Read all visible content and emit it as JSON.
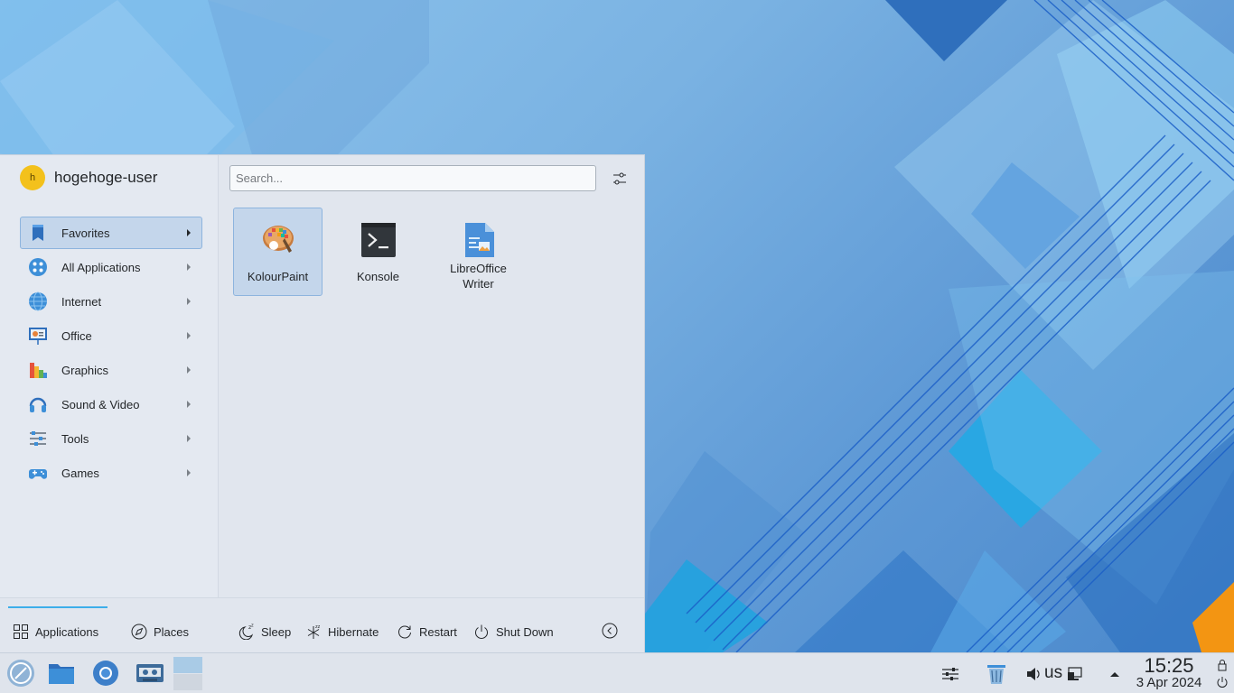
{
  "launcher": {
    "user": {
      "avatar_letter": "h",
      "name": "hogehoge-user"
    },
    "search": {
      "placeholder": "Search...",
      "value": ""
    },
    "categories": [
      {
        "label": "Favorites",
        "icon": "bookmark-icon",
        "selected": true
      },
      {
        "label": "All Applications",
        "icon": "all-applications-icon"
      },
      {
        "label": "Internet",
        "icon": "globe-icon"
      },
      {
        "label": "Office",
        "icon": "presentation-icon"
      },
      {
        "label": "Graphics",
        "icon": "color-palette-icon"
      },
      {
        "label": "Sound & Video",
        "icon": "headphones-icon"
      },
      {
        "label": "Tools",
        "icon": "sliders-icon"
      },
      {
        "label": "Games",
        "icon": "gamepad-icon"
      }
    ],
    "apps": [
      {
        "label": "KolourPaint",
        "icon": "kolourpaint-icon",
        "selected": true
      },
      {
        "label": "Konsole",
        "icon": "konsole-icon"
      },
      {
        "label": "LibreOffice Writer",
        "label_line1": "LibreOffice",
        "label_line2": "Writer",
        "icon": "libreoffice-writer-icon"
      }
    ],
    "footer": {
      "tabs": [
        {
          "label": "Applications",
          "icon": "grid-icon",
          "active": true
        },
        {
          "label": "Places",
          "icon": "compass-icon"
        }
      ],
      "power": [
        {
          "label": "Sleep",
          "icon": "sleep-icon"
        },
        {
          "label": "Hibernate",
          "icon": "hibernate-icon"
        },
        {
          "label": "Restart",
          "icon": "restart-icon"
        },
        {
          "label": "Shut Down",
          "icon": "shutdown-icon"
        }
      ]
    }
  },
  "taskbar": {
    "launchers": [
      "application-launcher-icon",
      "file-manager-icon",
      "web-browser-icon",
      "media-player-icon"
    ],
    "tray": {
      "keyboard_layout": "us",
      "time": "15:25",
      "date": "3 Apr 2024"
    }
  },
  "colors": {
    "accent": "#3daee9",
    "selection_bg": "#c4d6eb",
    "selection_border": "#8db4de",
    "panel_bg": "#e1e6ee"
  }
}
